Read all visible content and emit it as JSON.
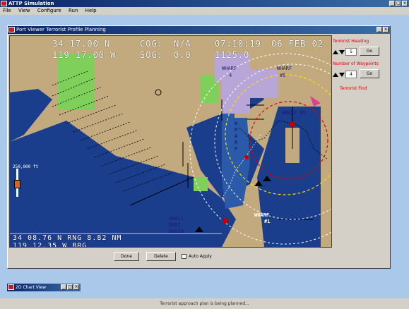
{
  "app": {
    "title": "ATTP Simulation"
  },
  "menu": [
    "File",
    "View",
    "Configure",
    "Run",
    "Help"
  ],
  "window": {
    "title": "Port Viewer Terrorist Profile Planning"
  },
  "readout": {
    "lat": "34 17.00 N",
    "lon": "119 17.00 W",
    "cog_label": "COG:",
    "cog_value": "N/A",
    "sog_label": "SOG:",
    "sog_value": "0.0",
    "time": "07:10:19",
    "heading_value": "1125.0",
    "date": "06 FEB 02"
  },
  "range_readout": "34 08.76 N RNG 8.82 NM",
  "range_readout2": "119 12.35 W BRG",
  "scale_label": "250,000 ft",
  "chart_labels": {
    "wharf1": "WHARF",
    "wharf1b": "4",
    "wharf2": "WHARF",
    "wharf2b": "#5",
    "wharf3": "WHARF #5",
    "wharf4": "WHARF",
    "wharf4b": "#1",
    "vertical_wharf": "WHARF",
    "small_boat": "SMALL BOAT BASIN"
  },
  "side_panel": {
    "heading_label": "Terrorist Heading",
    "heading_value": "5",
    "waypoints_label": "Number of Waypoints",
    "waypoints_value": "4",
    "find_label": "Terrorist Find",
    "go1": "Go",
    "go2": "Go"
  },
  "buttons": {
    "done": "Done",
    "delete": "Delete",
    "auto_apply": "Auto Apply"
  },
  "minimized": {
    "title": "2D Chart View"
  },
  "status": "Terrorist approach plan is being planned..."
}
